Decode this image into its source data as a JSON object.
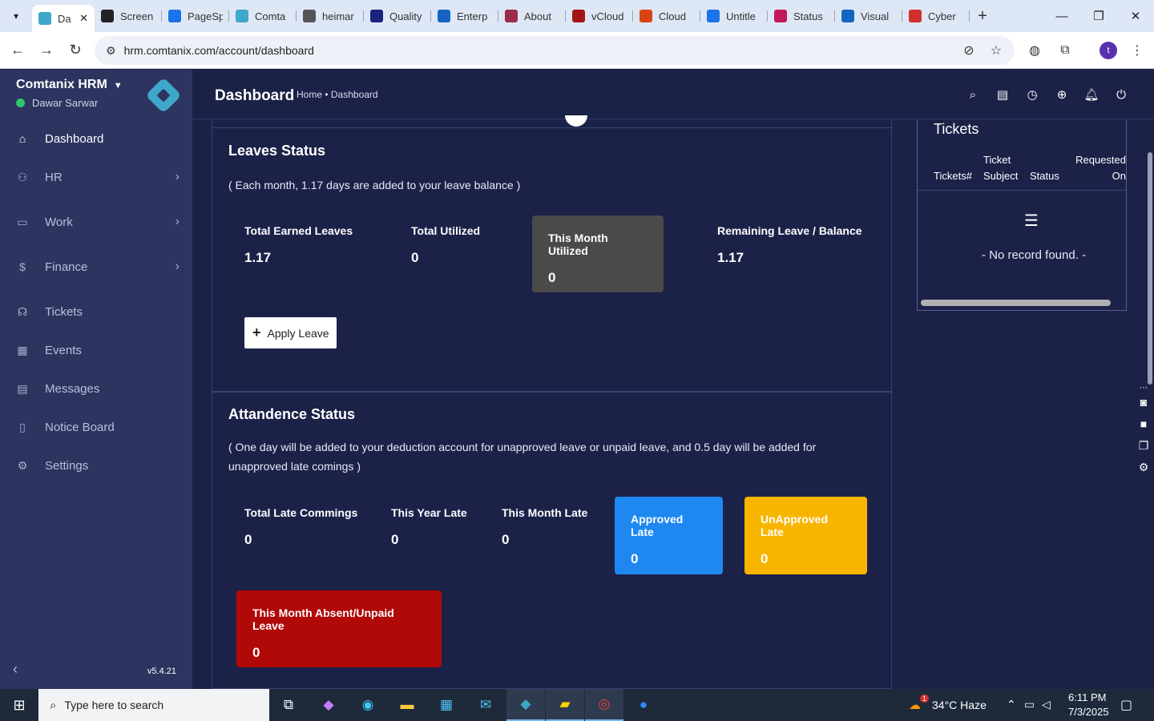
{
  "browser": {
    "tabs": [
      {
        "label": "Da",
        "active": true,
        "color": "#3fa7c9"
      },
      {
        "label": "Screen",
        "color": "#222222"
      },
      {
        "label": "PageSp",
        "color": "#1a73e8"
      },
      {
        "label": "Comta",
        "color": "#3fa7c9"
      },
      {
        "label": "heimar",
        "color": "#555555"
      },
      {
        "label": "Quality",
        "color": "#1a237e"
      },
      {
        "label": "Enterp",
        "color": "#1565c0"
      },
      {
        "label": "About",
        "color": "#9c2a4a"
      },
      {
        "label": "vCloud",
        "color": "#a31515"
      },
      {
        "label": "Cloud",
        "color": "#d84315"
      },
      {
        "label": "Untitle",
        "color": "#1a73e8"
      },
      {
        "label": "Status",
        "color": "#c2185b"
      },
      {
        "label": "Visual",
        "color": "#1565c0"
      },
      {
        "label": "Cyber",
        "color": "#d32f2f"
      }
    ],
    "url": "hrm.comtanix.com/account/dashboard",
    "profile_initial": "t"
  },
  "sidebar": {
    "brand": "Comtanix HRM",
    "user": "Dawar Sarwar",
    "version": "v5.4.21",
    "items": [
      {
        "label": "Dashboard",
        "icon": "home-icon",
        "active": true,
        "expandable": false
      },
      {
        "label": "HR",
        "icon": "users-icon",
        "expandable": true
      },
      {
        "label": "Work",
        "icon": "briefcase-icon",
        "expandable": true
      },
      {
        "label": "Finance",
        "icon": "dollar-icon",
        "expandable": true
      },
      {
        "label": "Tickets",
        "icon": "headset-icon",
        "expandable": false
      },
      {
        "label": "Events",
        "icon": "calendar-icon",
        "expandable": false
      },
      {
        "label": "Messages",
        "icon": "message-icon",
        "expandable": false
      },
      {
        "label": "Notice Board",
        "icon": "clipboard-icon",
        "expandable": false
      },
      {
        "label": "Settings",
        "icon": "gear-icon",
        "expandable": false
      }
    ]
  },
  "header": {
    "title": "Dashboard",
    "breadcrumb": "Home • Dashboard"
  },
  "leaves": {
    "title": "Leaves Status",
    "note": "( Each month, 1.17 days are added to your leave balance )",
    "stats": [
      {
        "label": "Total Earned Leaves",
        "value": "1.17"
      },
      {
        "label": "Total Utilized",
        "value": "0"
      },
      {
        "label": "This Month Utilized",
        "value": "0",
        "color": "#4a4a4a"
      },
      {
        "label": "Remaining Leave / Balance",
        "value": "1.17"
      }
    ],
    "apply_label": "Apply Leave"
  },
  "attendance": {
    "title": "Attandence Status",
    "note": "( One day will be added to your deduction account for unapproved leave or unpaid leave, and 0.5 day will be added for unapproved late comings )",
    "stats": [
      {
        "label": "Total Late Commings",
        "value": "0"
      },
      {
        "label": "This Year Late",
        "value": "0"
      },
      {
        "label": "This Month Late",
        "value": "0"
      },
      {
        "label": "Approved Late",
        "value": "0",
        "color": "#1e88f0"
      },
      {
        "label": "UnApproved Late",
        "value": "0",
        "color": "#f7b500"
      },
      {
        "label": "This Month Absent/Unpaid Leave",
        "value": "0",
        "color": "#b10808"
      }
    ]
  },
  "tickets": {
    "title": "Tickets",
    "columns": [
      "Tickets#",
      "Ticket Subject",
      "Status",
      "Requested On"
    ],
    "empty": "- No record found. -"
  },
  "taskbar": {
    "search_placeholder": "Type here to search",
    "weather": "34°C  Haze",
    "time": "6:11 PM",
    "date": "7/3/2025",
    "weather_badge": "1"
  }
}
